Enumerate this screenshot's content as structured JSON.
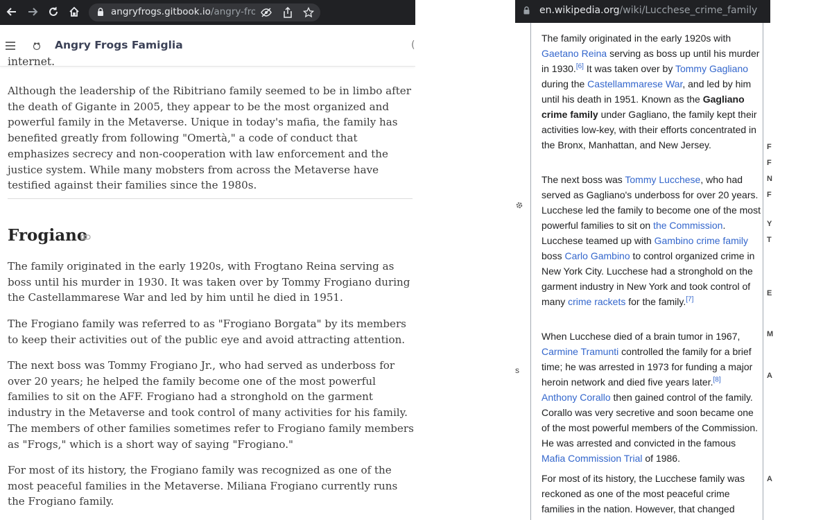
{
  "left": {
    "browser": {
      "url_domain": "angryfrogs.gitbook.io",
      "url_path": "/angry-fro...",
      "back_icon": "arrow-left-icon",
      "forward_icon": "arrow-right-icon",
      "reload_icon": "reload-icon",
      "home_icon": "home-icon"
    },
    "header": {
      "menu_icon": "hamburger-menu-icon",
      "title": "Angry Frogs Famiglia",
      "search_partial": "("
    },
    "content": {
      "cut_off_line": "internet.",
      "para_intro": "Although the leadership of the Ribitriano family seemed to be in limbo after the death of Gigante in 2005, they appear to be the most organized and powerful family in the Metaverse. Unique in today's mafia, the family has benefited greatly from following \"Omertà,\" a code of conduct that emphasizes secrecy and non-cooperation with law enforcement and the justice system. While many mobsters from across the Metaverse have testified against their families since the 1980s.",
      "heading": "Frogiano",
      "paragraphs": [
        "The family originated in the early 1920s, with Frogtano Reina serving as boss until his murder in 1930. It was taken over by Tommy Frogiano during the Castellammarese War and led by him until he died in 1951.",
        "The Frogiano family was referred to as \"Frogiano Borgata\" by its members to keep their activities out of the public eye and avoid attracting attention.",
        "The next boss was Tommy Frogiano Jr., who had served as underboss for over 20 years; he helped the family become one of the most powerful families to sit on the AFF. Frogiano had a stronghold on the garment industry in the Metaverse and took control of many activities for his family. The members of other families sometimes refer to Frogiano family members as \"Frogs,\" which is a short way of saying \"Frogiano.\"",
        "For most of its history, the Frogiano family was recognized as one of the most peaceful families in the Metaverse. Miliana Frogiano currently runs the Frogiano family."
      ]
    }
  },
  "right": {
    "browser": {
      "url_domain": "en.wikipedia.org",
      "url_path": "/wiki/Lucchese_crime_family"
    },
    "p1": {
      "t1": "The family originated in the early 1920s with ",
      "l1": "Gaetano Reina",
      "t2": " serving as boss up until his murder in 1930.",
      "s1": "[6]",
      "t3": " It was taken over by ",
      "l2": "Tommy Gagliano",
      "t4": " during the ",
      "l3": "Castellammarese War",
      "t5": ", and led by him until his death in 1951. Known as the ",
      "b1": "Gagliano crime family",
      "t6": " under Gagliano, the family kept their activities low-key, with their efforts concentrated in the Bronx, Manhattan, and New Jersey."
    },
    "p2": {
      "t1": "The next boss was ",
      "l1": "Tommy Lucchese",
      "t2": ", who had served as Gagliano's underboss for over 20 years. Lucchese led the family to become one of the most powerful families to sit on ",
      "l2": "the Commission",
      "t3": ". Lucchese teamed up with ",
      "l3": "Gambino crime family",
      "t4": " boss ",
      "l4": "Carlo Gambino",
      "t5": " to control organized crime in New York City. Lucchese had a stronghold on the garment industry in New York and took control of many ",
      "l5": "crime rackets",
      "t6": " for the family.",
      "s1": "[7]"
    },
    "p3": {
      "t1": "When Lucchese died of a brain tumor in 1967, ",
      "l1": "Carmine Tramunti",
      "t2": " controlled the family for a brief time; he was arrested in 1973 for funding a major heroin network and died five years later.",
      "s1": "[8]",
      "l2": "Anthony Corallo",
      "t3": " then gained control of the family. Corallo was very secretive and soon became one of the most powerful members of the Commission. He was arrested and convicted in the famous ",
      "l3": "Mafia Commission Trial",
      "t4": " of 1986."
    },
    "p4": {
      "t1": "For most of its history, the Lucchese family was reckoned as one of the most peaceful crime families in the nation. However, that changed"
    },
    "edge_letters": [
      "F",
      "F",
      "N",
      "F",
      "Y",
      "T",
      "E",
      "M",
      "A",
      "A"
    ],
    "edge_s": "s"
  },
  "colors": {
    "chrome_dark": "#202124",
    "wiki_link": "#3366cc",
    "gitbook_text": "#3b3b3b"
  }
}
